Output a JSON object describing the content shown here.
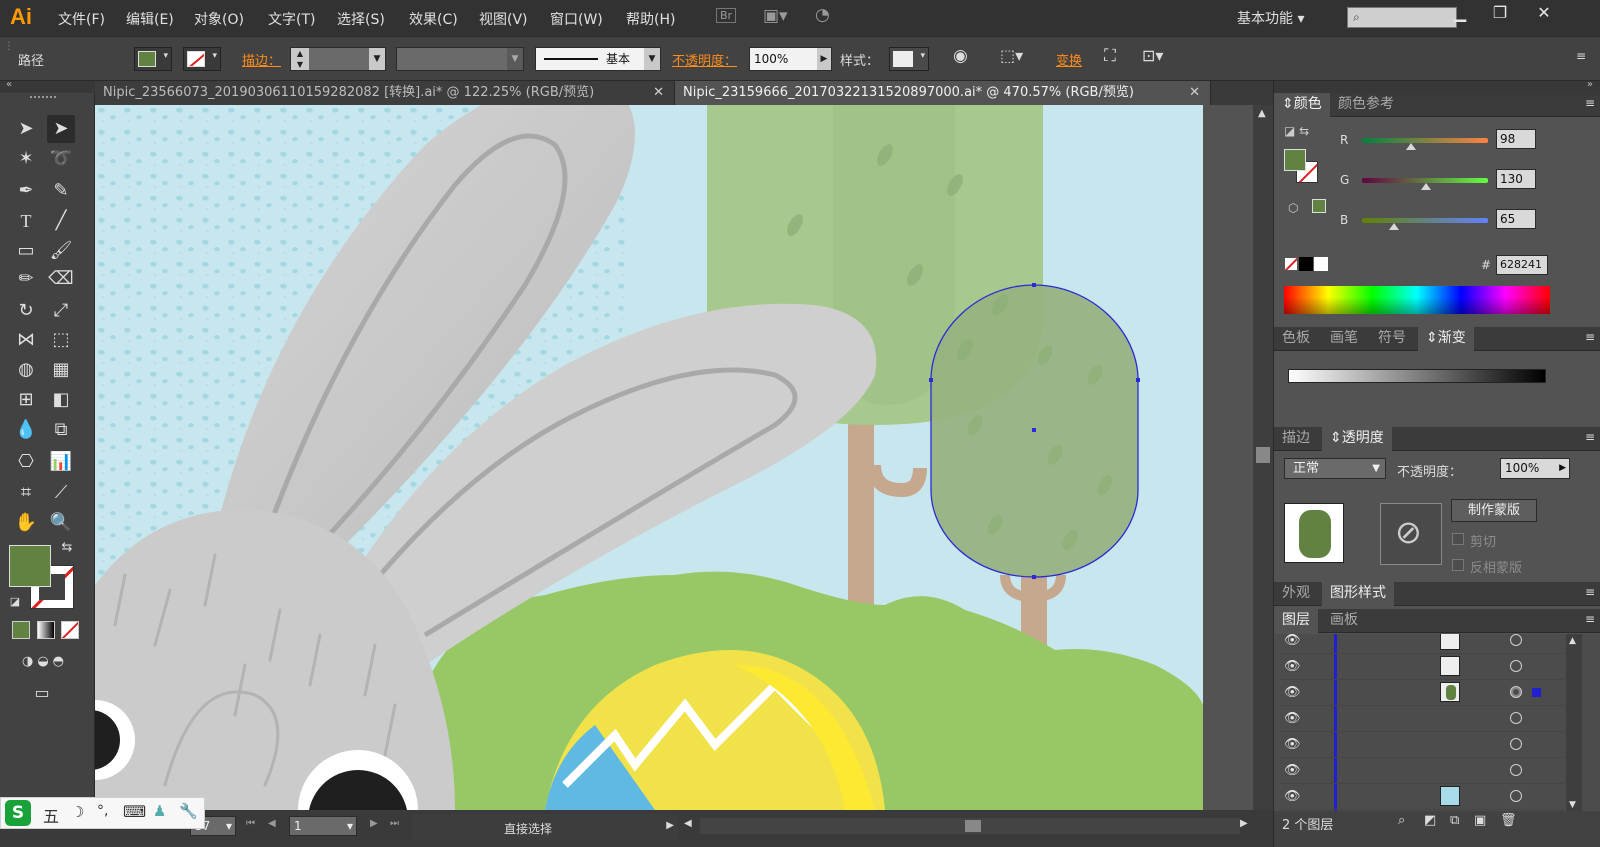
{
  "app": {
    "logo": "Ai",
    "menu": [
      "文件(F)",
      "编辑(E)",
      "对象(O)",
      "文字(T)",
      "选择(S)",
      "效果(C)",
      "视图(V)",
      "窗口(W)",
      "帮助(H)"
    ],
    "bridge_label": "Br",
    "workspace": "基本功能",
    "search_placeholder": "",
    "win_minimize": "▁",
    "win_restore": "❐",
    "win_close": "✕"
  },
  "control_bar": {
    "selection_type": "路径",
    "fill_color": "#628241",
    "stroke_label": "描边",
    "stroke_colon": "：",
    "stroke_profile": "基本",
    "opacity_label": "不透明度",
    "opacity_colon": "：",
    "opacity_value": "100%",
    "style_label": "样式",
    "style_colon": "：",
    "transform_label": "变换"
  },
  "tabs": [
    {
      "label": "Nipic_23566073_20190306110159282082 [转换].ai* @ 122.25% (RGB/预览)",
      "close": "✕"
    },
    {
      "label": "Nipic_23159666_20170322131520897000.ai* @ 470.57% (RGB/预览)",
      "close": "✕"
    }
  ],
  "status_bar": {
    "zoom_partial": "57",
    "page": "1",
    "tool_status": "直接选择"
  },
  "color_panel": {
    "tabs": [
      "颜色",
      "颜色参考"
    ],
    "r_label": "R",
    "r_value": "98",
    "g_label": "G",
    "g_value": "130",
    "b_label": "B",
    "b_value": "65",
    "hex_label": "#",
    "hex_value": "628241",
    "fill": "#628241"
  },
  "swatch_panel": {
    "tabs": [
      "色板",
      "画笔",
      "符号",
      "渐变"
    ]
  },
  "transparency_panel": {
    "tabs": [
      "描边",
      "透明度"
    ],
    "blend_mode": "正常",
    "opacity_label": "不透明度：",
    "opacity_value": "100%",
    "make_mask": "制作蒙版",
    "clip": "剪切",
    "invert_mask": "反相蒙版"
  },
  "appearance_panel": {
    "tabs": [
      "外观",
      "图形样式"
    ]
  },
  "layers_panel": {
    "tabs": [
      "图层",
      "画板"
    ],
    "count": "2 个图层"
  },
  "ime": {
    "mode": "五",
    "icons": [
      "moon-icon",
      "punct-icon",
      "keyboard-icon",
      "user-icon",
      "wrench-icon"
    ]
  }
}
